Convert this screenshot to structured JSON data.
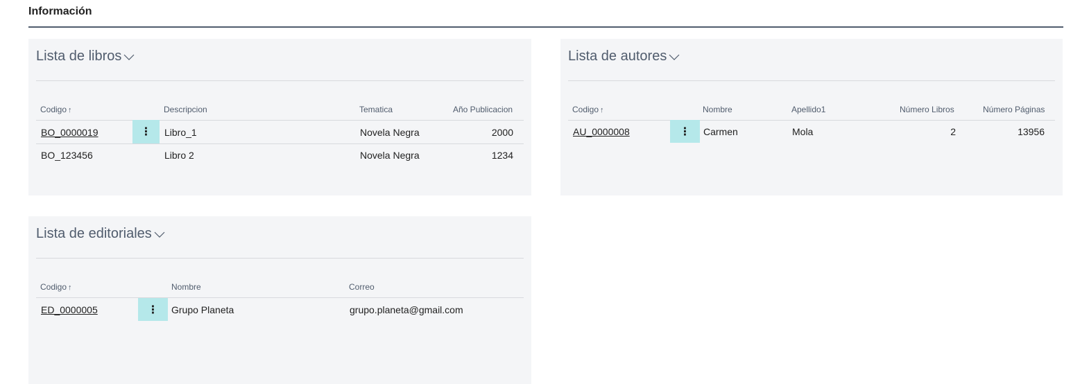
{
  "section": {
    "title": "Información"
  },
  "books": {
    "title": "Lista de libros",
    "sort_arrow": "↑",
    "columns": [
      "Codigo",
      "Descripcion",
      "Tematica",
      "Año Publicacion"
    ],
    "rows": [
      {
        "code": "BO_0000019",
        "description": "Libro_1",
        "theme": "Novela Negra",
        "year": "2000"
      },
      {
        "code": "BO_123456",
        "description": "Libro 2",
        "theme": "Novela Negra",
        "year": "1234"
      }
    ]
  },
  "authors": {
    "title": "Lista de autores",
    "sort_arrow": "↑",
    "columns": [
      "Codigo",
      "Nombre",
      "Apellido1",
      "Número Libros",
      "Número Páginas"
    ],
    "rows": [
      {
        "code": "AU_0000008",
        "name": "Carmen",
        "surname": "Mola",
        "books": "2",
        "pages": "13956"
      }
    ]
  },
  "publishers": {
    "title": "Lista de editoriales",
    "sort_arrow": "↑",
    "columns": [
      "Codigo",
      "Nombre",
      "Correo"
    ],
    "rows": [
      {
        "code": "ED_0000005",
        "name": "Grupo Planeta",
        "email": "grupo.planeta@gmail.com"
      }
    ]
  },
  "row_menu_glyph": "⋮"
}
